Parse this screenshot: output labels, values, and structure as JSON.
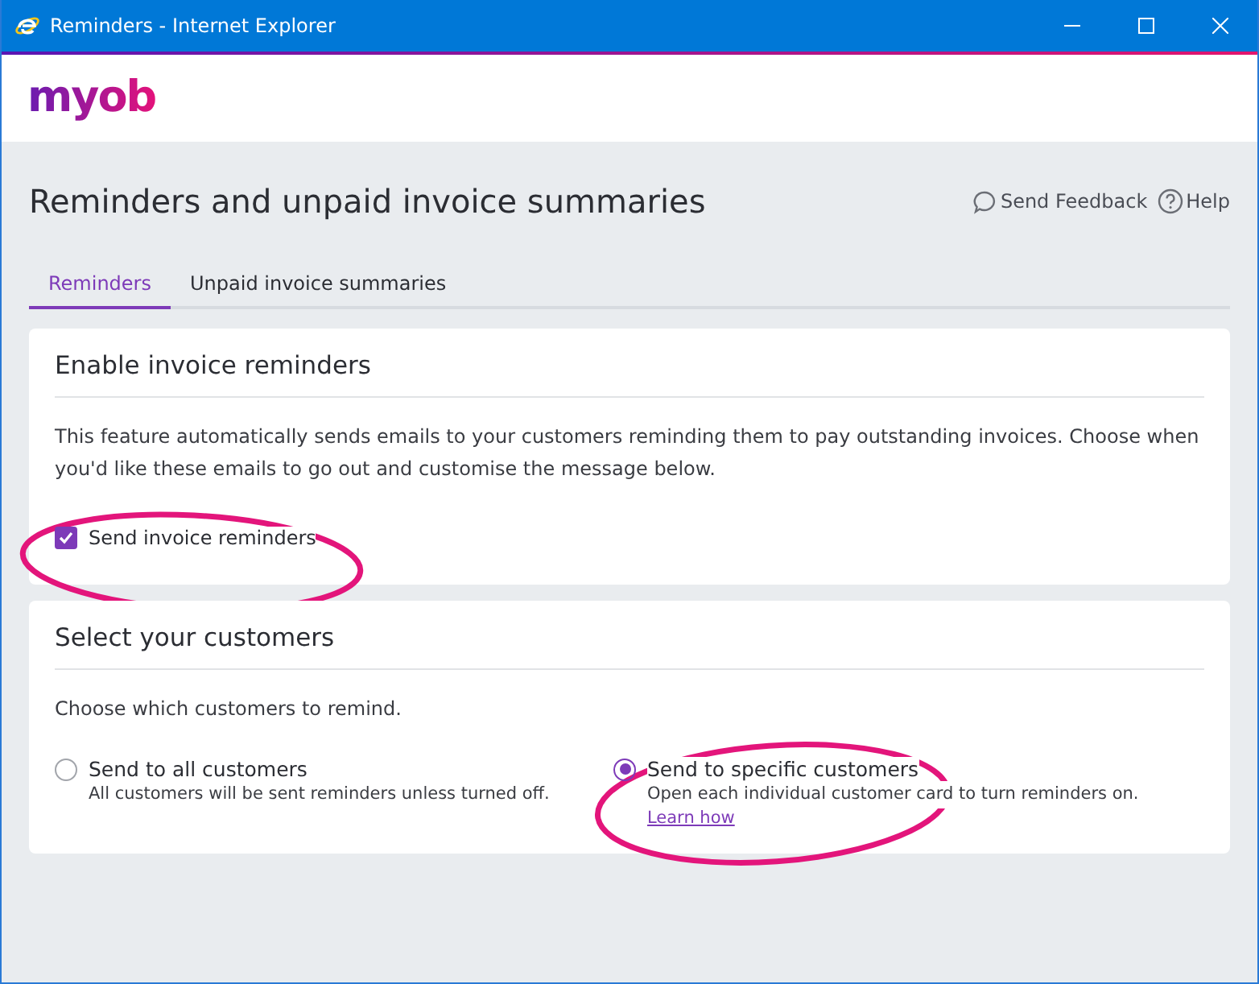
{
  "window": {
    "title": "Reminders - Internet Explorer"
  },
  "logo": "myob",
  "page": {
    "title": "Reminders and unpaid invoice summaries",
    "links": [
      {
        "kind": "feedback",
        "label": "Send Feedback"
      },
      {
        "kind": "help",
        "label": "Help"
      }
    ]
  },
  "tabs": [
    {
      "label": "Reminders",
      "selected": true
    },
    {
      "label": "Unpaid invoice summaries",
      "selected": false
    }
  ],
  "reminders_card": {
    "title": "Enable invoice reminders",
    "description": "This feature automatically sends emails to your customers reminding them to pay outstanding invoices. Choose when you'd like these emails to go out and customise the message below.",
    "checkbox": {
      "label": "Send invoice reminders",
      "checked": true,
      "circled": true
    }
  },
  "customers_card": {
    "title": "Select your customers",
    "prompt": "Choose which customers to remind.",
    "options": [
      {
        "label": "Send to all customers",
        "hint": "All customers will be sent reminders unless turned off.",
        "selected": false
      },
      {
        "label": "Send to specific customers",
        "hint": "Open each individual customer card to turn reminders on.",
        "link": "Learn how",
        "selected": true,
        "circled": true
      }
    ]
  }
}
